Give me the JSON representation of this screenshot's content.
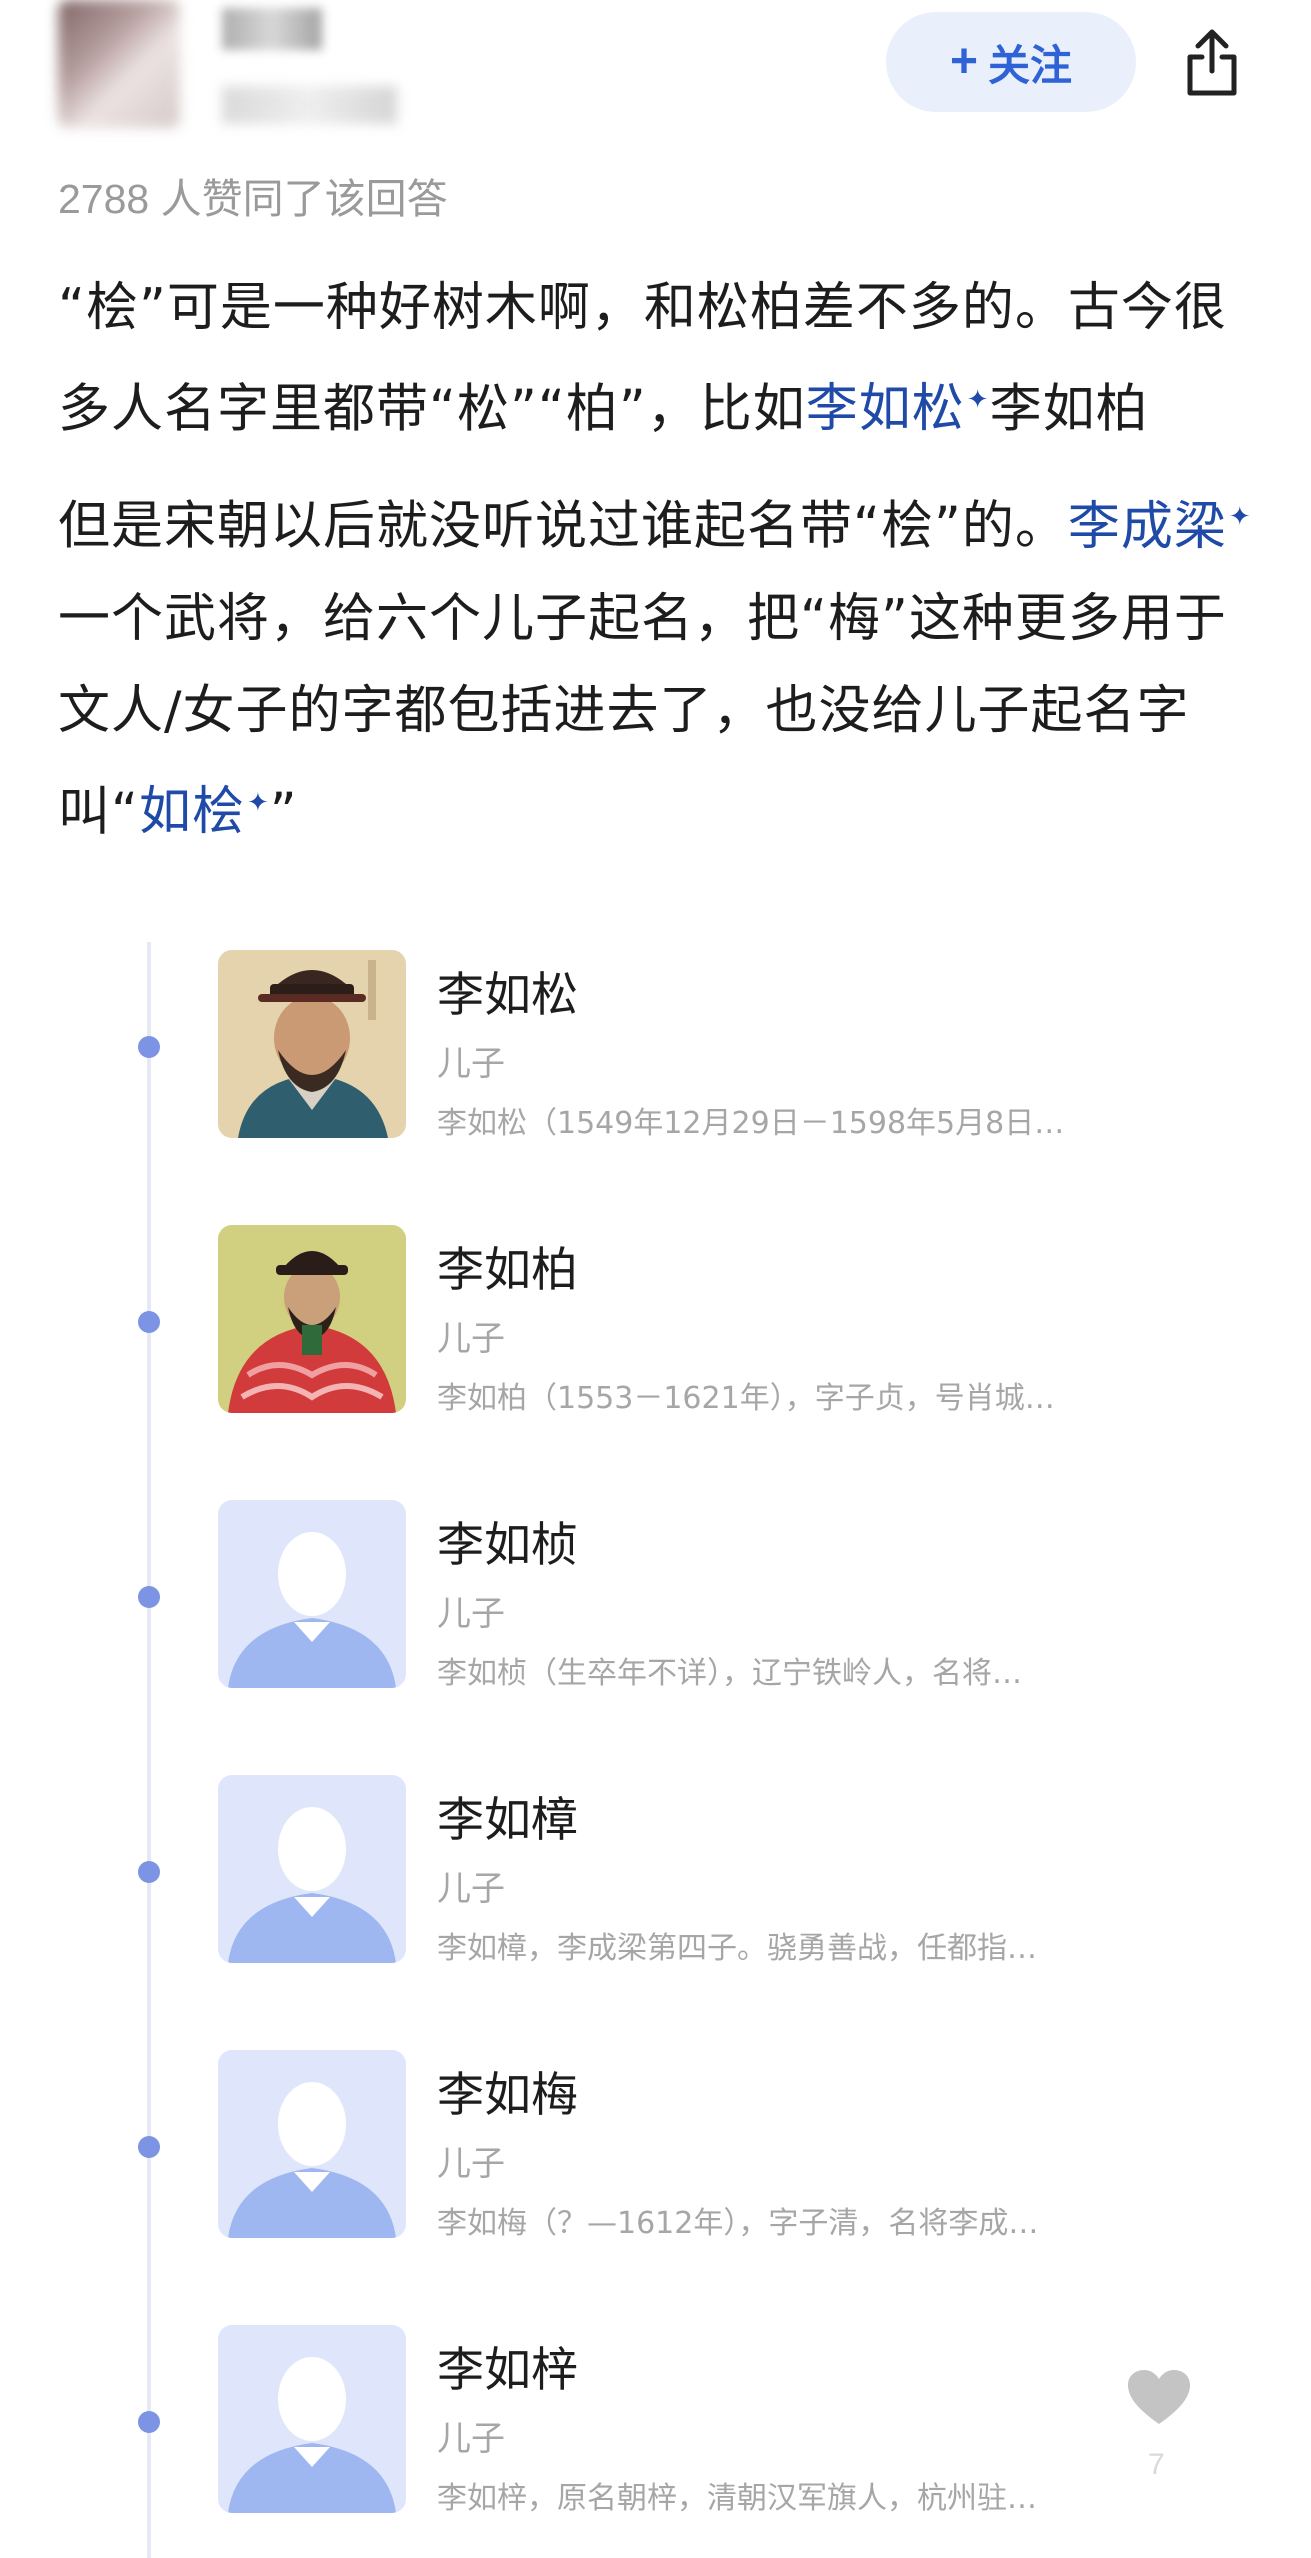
{
  "header": {
    "follow_label": "关注",
    "follow_icon": "plus-icon",
    "share_icon": "share-icon"
  },
  "answer": {
    "likes_text": "2788 人赞同了该回答",
    "p1_a": "“桧”可是一种好树木啊，和松柏差不多的。古今很多人名字里都带“松”“柏”，比如",
    "p1_link1": "李如松",
    "p1_b": "李如柏",
    "p2_link_a": "李成梁",
    "p2_a": "但是宋朝以后就没听说过谁起名带“桧”的。",
    "p2_b": "一个武将，给六个儿子起名，把“梅”这种更多用于文人/女子的字都包括进去了，也没给儿子起名字叫“",
    "p2_link_b": "如桧",
    "p2_c": "”",
    "link_marker": "✦"
  },
  "family": [
    {
      "name": "李如松",
      "relation": "儿子",
      "desc": "李如松（1549年12月29日－1598年5月8日…",
      "photo": "portrait-blue-robe"
    },
    {
      "name": "李如柏",
      "relation": "儿子",
      "desc": "李如柏（1553－1621年），字子贞，号肖城…",
      "photo": "portrait-red-robe"
    },
    {
      "name": "李如桢",
      "relation": "儿子",
      "desc": "李如桢（生卒年不详），辽宁铁岭人，名将…",
      "photo": "avatar-placeholder"
    },
    {
      "name": "李如樟",
      "relation": "儿子",
      "desc": "李如樟，李成梁第四子。骁勇善战，任都指…",
      "photo": "avatar-placeholder"
    },
    {
      "name": "李如梅",
      "relation": "儿子",
      "desc": "李如梅（？—1612年），字子清，名将李成…",
      "photo": "avatar-placeholder"
    },
    {
      "name": "李如梓",
      "relation": "儿子",
      "desc": "李如梓，原名朝梓，清朝汉军旗人，杭州驻…",
      "photo": "avatar-placeholder"
    }
  ],
  "floating": {
    "like_icon": "heart-icon",
    "like_count": "7"
  },
  "colors": {
    "accent": "#2f62d6",
    "link": "#1f4aa8",
    "follow_bg": "#e9f0fb",
    "muted_text": "#a6a6a6",
    "timeline_dot": "#7d93e3",
    "placeholder_bg": "#dfe6fb"
  }
}
